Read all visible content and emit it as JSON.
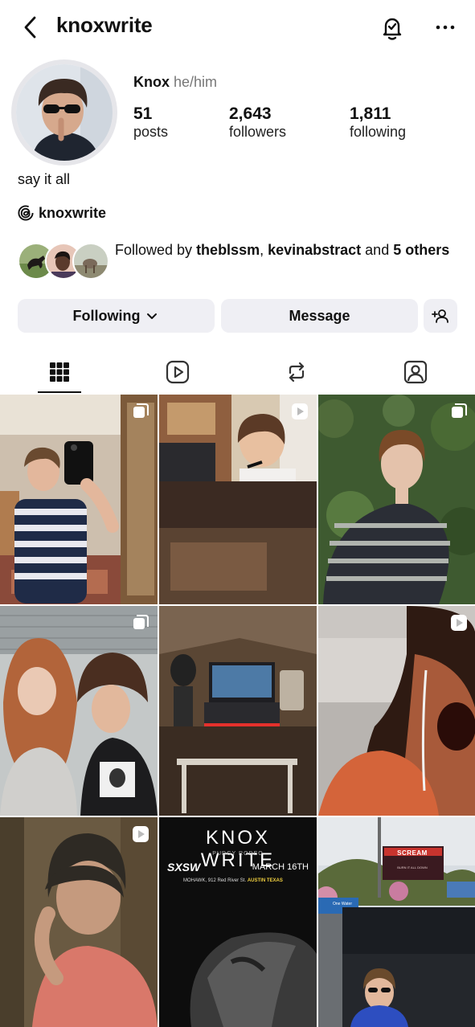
{
  "header": {
    "username": "knoxwrite"
  },
  "profile": {
    "name": "Knox",
    "pronouns": "he/him",
    "stats": [
      {
        "num": "51",
        "label": "posts"
      },
      {
        "num": "2,643",
        "label": "followers"
      },
      {
        "num": "1,811",
        "label": "following"
      }
    ],
    "bio": "say it all",
    "threads_handle": "knoxwrite"
  },
  "followed_by": {
    "prefix": "Followed by ",
    "user1": "theblssm",
    "sep": ", ",
    "user2": "kevinabstract",
    "and": " and ",
    "others": "5 others"
  },
  "actions": {
    "following_label": "Following",
    "message_label": "Message"
  },
  "tabs": [
    "grid",
    "reels",
    "reposts",
    "tagged"
  ],
  "posts": [
    {
      "badge": "multi"
    },
    {
      "badge": "reel"
    },
    {
      "badge": "multi"
    },
    {
      "badge": "multi"
    },
    {
      "badge": "none"
    },
    {
      "badge": "reel"
    },
    {
      "badge": "reel"
    },
    {
      "badge": "none"
    },
    {
      "badge": "none"
    }
  ],
  "poster": {
    "title": "KNOX WRITE",
    "sub": "PUDGY RODEO",
    "event": "SXSW",
    "date": "MARCH 16TH",
    "venue": "MOHAWK, 912 Red River St.",
    "city": "AUSTIN TEXAS"
  },
  "billboard": {
    "title": "SCREAM",
    "tag": "BURN IT ALL DOWN",
    "sign": "One Water"
  }
}
